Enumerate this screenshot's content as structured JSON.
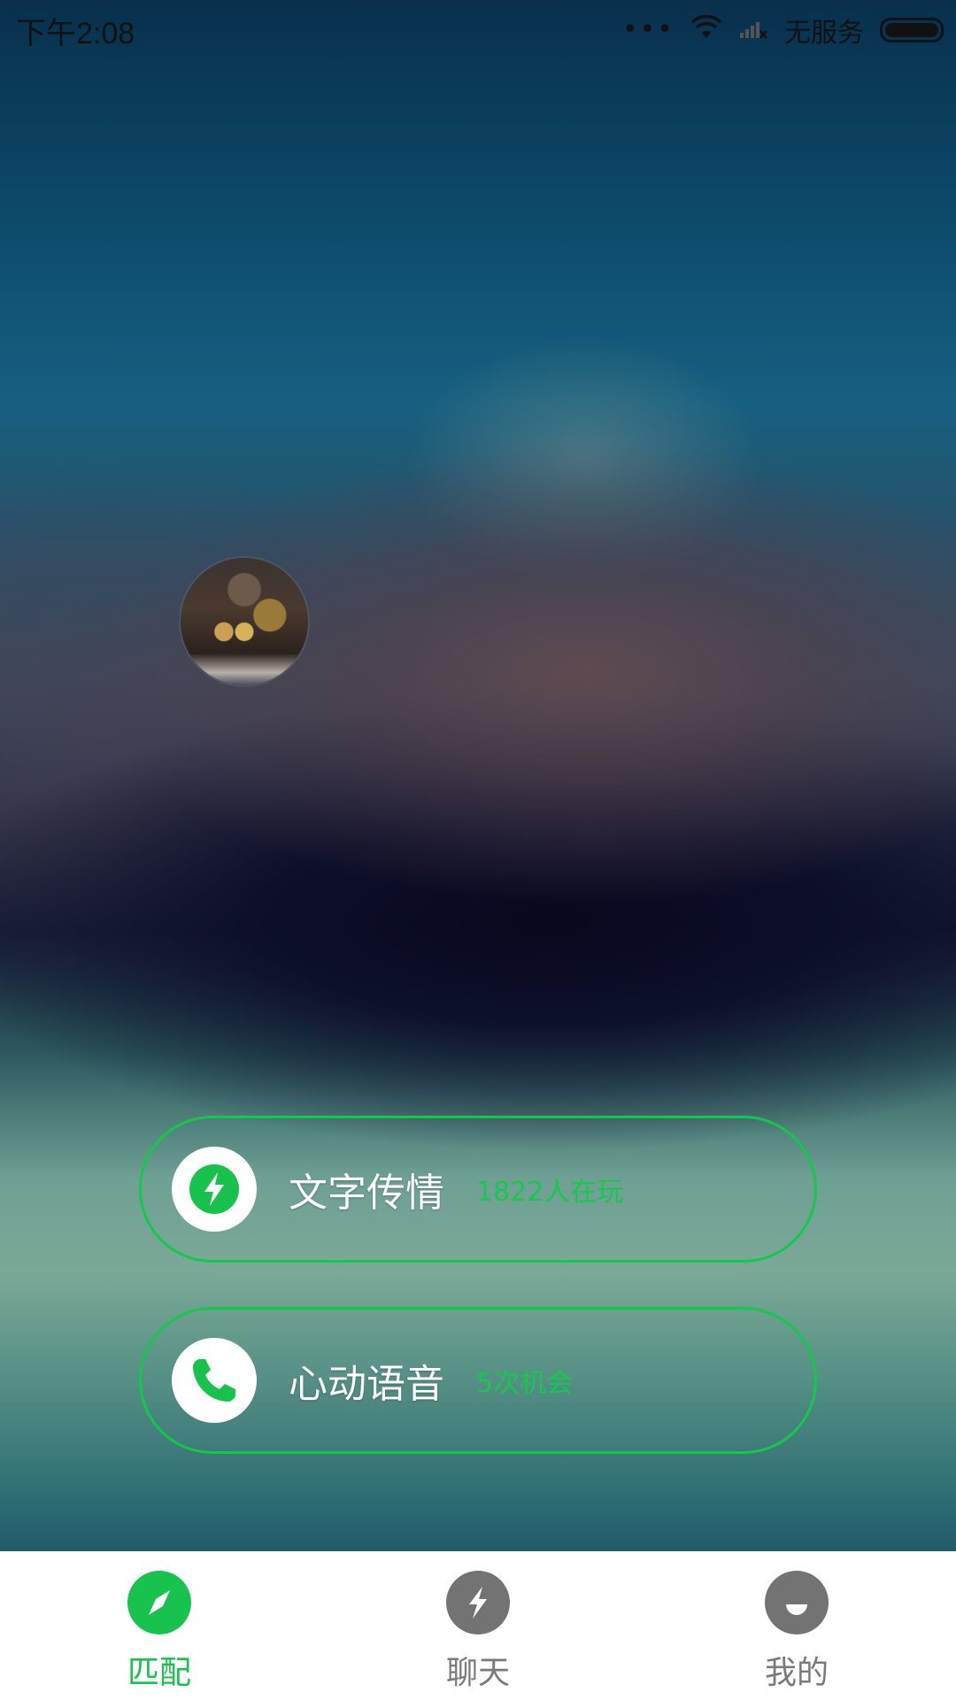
{
  "status_bar": {
    "time": "下午2:08",
    "dots": "•••",
    "carrier": "无服务"
  },
  "modes": [
    {
      "title": "文字传情",
      "subtitle": "1822人在玩",
      "icon": "lightning-icon"
    },
    {
      "title": "心动语音",
      "subtitle": "5次机会",
      "icon": "phone-icon"
    }
  ],
  "tabs": [
    {
      "label": "匹配",
      "icon": "compass-icon",
      "active": true
    },
    {
      "label": "聊天",
      "icon": "lightning-icon",
      "active": false
    },
    {
      "label": "我的",
      "icon": "smile-icon",
      "active": false
    }
  ],
  "colors": {
    "accent": "#17c24d",
    "inactive": "#7a7a7a",
    "tabbar_bg": "#ffffff"
  }
}
